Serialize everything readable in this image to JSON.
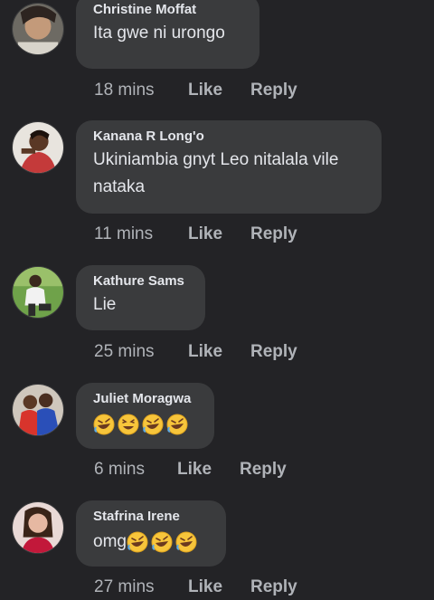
{
  "comments": [
    {
      "name": "Christine Moffat",
      "text": "Ita gwe ni urongo",
      "time": "18 mins",
      "like": "Like",
      "reply": "Reply"
    },
    {
      "name": "Kanana R Long'o",
      "text": "Ukiniambia gnyt Leo nitalala vile nataka",
      "time": "11 mins",
      "like": "Like",
      "reply": "Reply"
    },
    {
      "name": "Kathure Sams",
      "text": "Lie",
      "time": "25 mins",
      "like": "Like",
      "reply": "Reply"
    },
    {
      "name": "Juliet Moragwa",
      "text": "",
      "emoji": [
        "rolling-on-floor-laughing",
        "grinning-squinting",
        "rolling-on-floor-laughing",
        "rolling-on-floor-laughing"
      ],
      "time": "6 mins",
      "like": "Like",
      "reply": "Reply"
    },
    {
      "name": "Stafrina Irene",
      "text": "omg",
      "emoji": [
        "rolling-on-floor-laughing",
        "rolling-on-floor-laughing",
        "rolling-on-floor-laughing"
      ],
      "time": "27 mins",
      "like": "Like",
      "reply": "Reply"
    }
  ],
  "colors": {
    "background": "#232326",
    "bubble": "#3a3b3d",
    "name": "#e4e6eb",
    "meta": "#b0b3b8",
    "emoji": "#f7c53b"
  }
}
